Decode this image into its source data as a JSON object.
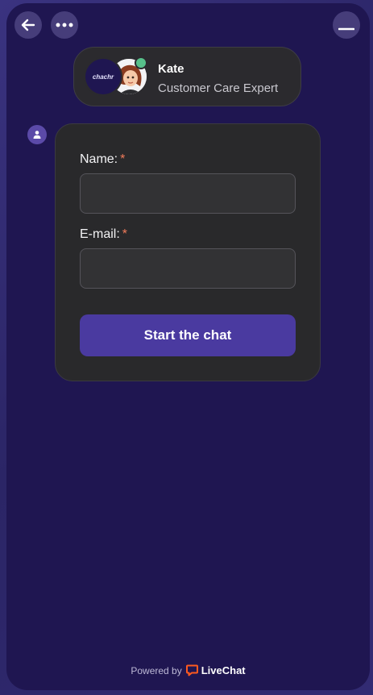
{
  "header": {
    "back_icon": "arrow-left-icon",
    "menu_icon": "more-dots-icon",
    "minimize_icon": "minimize-icon"
  },
  "agent": {
    "logo_text": "chachr",
    "name": "Kate",
    "role": "Customer Care Expert",
    "status_color": "#57c08a"
  },
  "form": {
    "name_label": "Name:",
    "email_label": "E-mail:",
    "required_mark": "*",
    "name_value": "",
    "email_value": "",
    "submit_label": "Start the chat"
  },
  "footer": {
    "powered_text": "Powered by",
    "brand_name": "LiveChat",
    "brand_color": "#ff5a1f"
  },
  "colors": {
    "widget_bg": "#1f1651",
    "card_bg": "#29292b",
    "accent": "#4a3aa0",
    "required": "#f27b5a"
  }
}
